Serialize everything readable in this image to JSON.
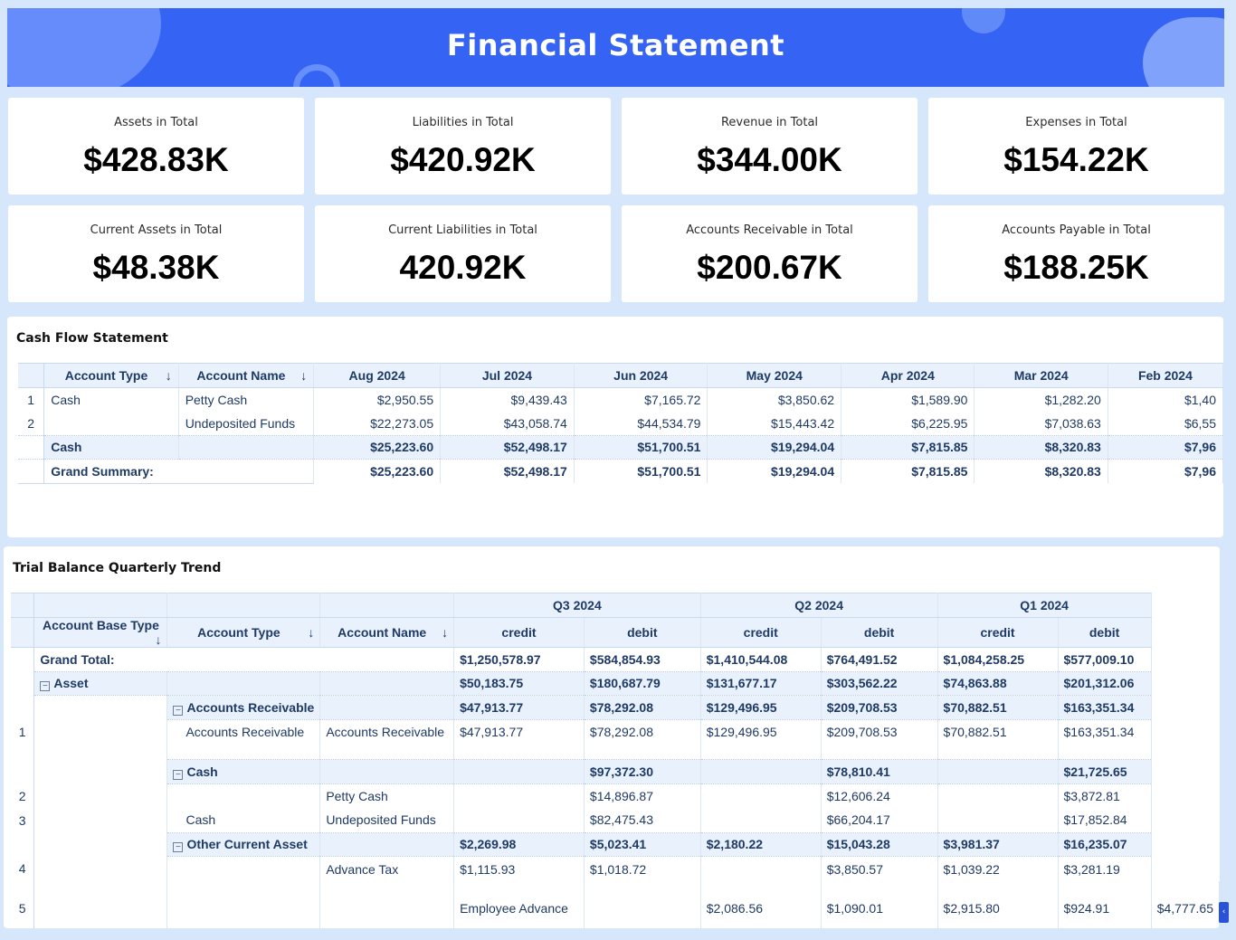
{
  "header": {
    "title": "Financial Statement"
  },
  "kpis": [
    {
      "label": "Assets in Total",
      "value": "$428.83K"
    },
    {
      "label": "Liabilities in Total",
      "value": "$420.92K"
    },
    {
      "label": "Revenue in Total",
      "value": "$344.00K"
    },
    {
      "label": "Expenses in Total",
      "value": "$154.22K"
    },
    {
      "label": "Current Assets in Total",
      "value": "$48.38K"
    },
    {
      "label": "Current Liabilities in Total",
      "value": "420.92K"
    },
    {
      "label": "Accounts Receivable in Total",
      "value": "$200.67K"
    },
    {
      "label": "Accounts Payable in Total",
      "value": "$188.25K"
    }
  ],
  "cash_flow": {
    "title": "Cash Flow Statement",
    "col_account_type": "Account Type",
    "col_account_name": "Account Name",
    "months": [
      "Aug 2024",
      "Jul 2024",
      "Jun 2024",
      "May 2024",
      "Apr 2024",
      "Mar 2024",
      "Feb 2024"
    ],
    "rows": [
      {
        "num": "1",
        "type": "Cash",
        "name": "Petty Cash",
        "values": [
          "$2,950.55",
          "$9,439.43",
          "$7,165.72",
          "$3,850.62",
          "$1,589.90",
          "$1,282.20",
          "$1,40"
        ]
      },
      {
        "num": "2",
        "type": "",
        "name": "Undeposited Funds",
        "values": [
          "$22,273.05",
          "$43,058.74",
          "$44,534.79",
          "$15,443.42",
          "$6,225.95",
          "$7,038.63",
          "$6,55"
        ]
      }
    ],
    "subtotal": {
      "label": "Cash",
      "values": [
        "$25,223.60",
        "$52,498.17",
        "$51,700.51",
        "$19,294.04",
        "$7,815.85",
        "$8,320.83",
        "$7,96"
      ]
    },
    "grand": {
      "label": "Grand Summary:",
      "values": [
        "$25,223.60",
        "$52,498.17",
        "$51,700.51",
        "$19,294.04",
        "$7,815.85",
        "$8,320.83",
        "$7,96"
      ]
    }
  },
  "trial_balance": {
    "title": "Trial Balance Quarterly Trend",
    "quarters": [
      "Q3 2024",
      "Q2 2024",
      "Q1 2024"
    ],
    "col_base_type": "Account Base Type",
    "col_account_type": "Account Type",
    "col_account_name": "Account Name",
    "credit": "credit",
    "debit": "debit",
    "grand": {
      "label": "Grand Total:",
      "values": [
        "$1,250,578.97",
        "$584,854.93",
        "$1,410,544.08",
        "$764,491.52",
        "$1,084,258.25",
        "$577,009.10"
      ]
    },
    "asset": {
      "label": "Asset",
      "values": [
        "$50,183.75",
        "$180,687.79",
        "$131,677.17",
        "$303,562.22",
        "$74,863.88",
        "$201,312.06"
      ]
    },
    "ar_group": {
      "label": "Accounts Receivable",
      "values": [
        "$47,913.77",
        "$78,292.08",
        "$129,496.95",
        "$209,708.53",
        "$70,882.51",
        "$163,351.34"
      ]
    },
    "ar_row": {
      "num": "1",
      "type": "Accounts Receivable",
      "name": "Accounts Receivable",
      "values": [
        "$47,913.77",
        "$78,292.08",
        "$129,496.95",
        "$209,708.53",
        "$70,882.51",
        "$163,351.34"
      ]
    },
    "cash_group": {
      "label": "Cash",
      "values": [
        "",
        "$97,372.30",
        "",
        "$78,810.41",
        "",
        "$21,725.65"
      ]
    },
    "cash_row1": {
      "num": "2",
      "type": "",
      "name": "Petty Cash",
      "values": [
        "",
        "$14,896.87",
        "",
        "$12,606.24",
        "",
        "$3,872.81"
      ]
    },
    "cash_row2": {
      "num": "3",
      "type": "Cash",
      "name": "Undeposited Funds",
      "values": [
        "",
        "$82,475.43",
        "",
        "$66,204.17",
        "",
        "$17,852.84"
      ]
    },
    "oca_group": {
      "label": "Other Current Asset",
      "values": [
        "$2,269.98",
        "$5,023.41",
        "$2,180.22",
        "$15,043.28",
        "$3,981.37",
        "$16,235.07"
      ]
    },
    "oca_row1": {
      "num": "4",
      "type": "",
      "name": "Advance Tax",
      "values": [
        "$1,115.93",
        "$1,018.72",
        "",
        "$3,850.57",
        "$1,039.22",
        "$3,281.19"
      ]
    },
    "oca_row2": {
      "num": "5",
      "type": "",
      "name": "Employee Advance",
      "values": [
        "",
        "$2,086.56",
        "$1,090.01",
        "$2,915.80",
        "$924.91",
        "$4,777.65"
      ]
    }
  }
}
